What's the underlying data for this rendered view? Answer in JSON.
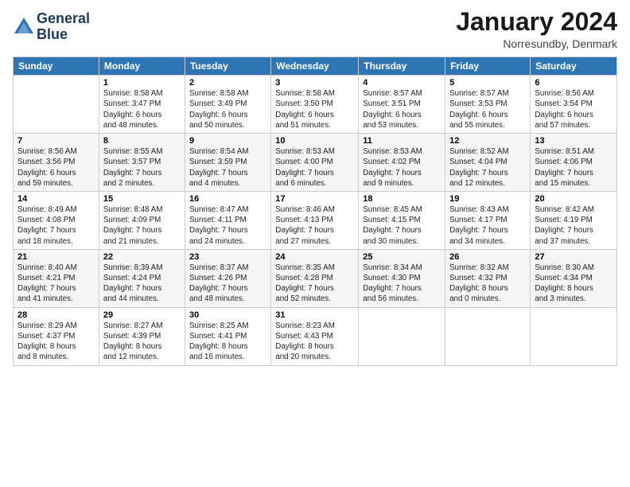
{
  "logo": {
    "line1": "General",
    "line2": "Blue"
  },
  "title": "January 2024",
  "subtitle": "Norresundby, Denmark",
  "header_days": [
    "Sunday",
    "Monday",
    "Tuesday",
    "Wednesday",
    "Thursday",
    "Friday",
    "Saturday"
  ],
  "weeks": [
    [
      {
        "day": "",
        "info": ""
      },
      {
        "day": "1",
        "info": "Sunrise: 8:58 AM\nSunset: 3:47 PM\nDaylight: 6 hours\nand 48 minutes."
      },
      {
        "day": "2",
        "info": "Sunrise: 8:58 AM\nSunset: 3:49 PM\nDaylight: 6 hours\nand 50 minutes."
      },
      {
        "day": "3",
        "info": "Sunrise: 8:58 AM\nSunset: 3:50 PM\nDaylight: 6 hours\nand 51 minutes."
      },
      {
        "day": "4",
        "info": "Sunrise: 8:57 AM\nSunset: 3:51 PM\nDaylight: 6 hours\nand 53 minutes."
      },
      {
        "day": "5",
        "info": "Sunrise: 8:57 AM\nSunset: 3:53 PM\nDaylight: 6 hours\nand 55 minutes."
      },
      {
        "day": "6",
        "info": "Sunrise: 8:56 AM\nSunset: 3:54 PM\nDaylight: 6 hours\nand 57 minutes."
      }
    ],
    [
      {
        "day": "7",
        "info": "Sunrise: 8:56 AM\nSunset: 3:56 PM\nDaylight: 6 hours\nand 59 minutes."
      },
      {
        "day": "8",
        "info": "Sunrise: 8:55 AM\nSunset: 3:57 PM\nDaylight: 7 hours\nand 2 minutes."
      },
      {
        "day": "9",
        "info": "Sunrise: 8:54 AM\nSunset: 3:59 PM\nDaylight: 7 hours\nand 4 minutes."
      },
      {
        "day": "10",
        "info": "Sunrise: 8:53 AM\nSunset: 4:00 PM\nDaylight: 7 hours\nand 6 minutes."
      },
      {
        "day": "11",
        "info": "Sunrise: 8:53 AM\nSunset: 4:02 PM\nDaylight: 7 hours\nand 9 minutes."
      },
      {
        "day": "12",
        "info": "Sunrise: 8:52 AM\nSunset: 4:04 PM\nDaylight: 7 hours\nand 12 minutes."
      },
      {
        "day": "13",
        "info": "Sunrise: 8:51 AM\nSunset: 4:06 PM\nDaylight: 7 hours\nand 15 minutes."
      }
    ],
    [
      {
        "day": "14",
        "info": "Sunrise: 8:49 AM\nSunset: 4:08 PM\nDaylight: 7 hours\nand 18 minutes."
      },
      {
        "day": "15",
        "info": "Sunrise: 8:48 AM\nSunset: 4:09 PM\nDaylight: 7 hours\nand 21 minutes."
      },
      {
        "day": "16",
        "info": "Sunrise: 8:47 AM\nSunset: 4:11 PM\nDaylight: 7 hours\nand 24 minutes."
      },
      {
        "day": "17",
        "info": "Sunrise: 8:46 AM\nSunset: 4:13 PM\nDaylight: 7 hours\nand 27 minutes."
      },
      {
        "day": "18",
        "info": "Sunrise: 8:45 AM\nSunset: 4:15 PM\nDaylight: 7 hours\nand 30 minutes."
      },
      {
        "day": "19",
        "info": "Sunrise: 8:43 AM\nSunset: 4:17 PM\nDaylight: 7 hours\nand 34 minutes."
      },
      {
        "day": "20",
        "info": "Sunrise: 8:42 AM\nSunset: 4:19 PM\nDaylight: 7 hours\nand 37 minutes."
      }
    ],
    [
      {
        "day": "21",
        "info": "Sunrise: 8:40 AM\nSunset: 4:21 PM\nDaylight: 7 hours\nand 41 minutes."
      },
      {
        "day": "22",
        "info": "Sunrise: 8:39 AM\nSunset: 4:24 PM\nDaylight: 7 hours\nand 44 minutes."
      },
      {
        "day": "23",
        "info": "Sunrise: 8:37 AM\nSunset: 4:26 PM\nDaylight: 7 hours\nand 48 minutes."
      },
      {
        "day": "24",
        "info": "Sunrise: 8:35 AM\nSunset: 4:28 PM\nDaylight: 7 hours\nand 52 minutes."
      },
      {
        "day": "25",
        "info": "Sunrise: 8:34 AM\nSunset: 4:30 PM\nDaylight: 7 hours\nand 56 minutes."
      },
      {
        "day": "26",
        "info": "Sunrise: 8:32 AM\nSunset: 4:32 PM\nDaylight: 8 hours\nand 0 minutes."
      },
      {
        "day": "27",
        "info": "Sunrise: 8:30 AM\nSunset: 4:34 PM\nDaylight: 8 hours\nand 3 minutes."
      }
    ],
    [
      {
        "day": "28",
        "info": "Sunrise: 8:29 AM\nSunset: 4:37 PM\nDaylight: 8 hours\nand 8 minutes."
      },
      {
        "day": "29",
        "info": "Sunrise: 8:27 AM\nSunset: 4:39 PM\nDaylight: 8 hours\nand 12 minutes."
      },
      {
        "day": "30",
        "info": "Sunrise: 8:25 AM\nSunset: 4:41 PM\nDaylight: 8 hours\nand 16 minutes."
      },
      {
        "day": "31",
        "info": "Sunrise: 8:23 AM\nSunset: 4:43 PM\nDaylight: 8 hours\nand 20 minutes."
      },
      {
        "day": "",
        "info": ""
      },
      {
        "day": "",
        "info": ""
      },
      {
        "day": "",
        "info": ""
      }
    ]
  ]
}
